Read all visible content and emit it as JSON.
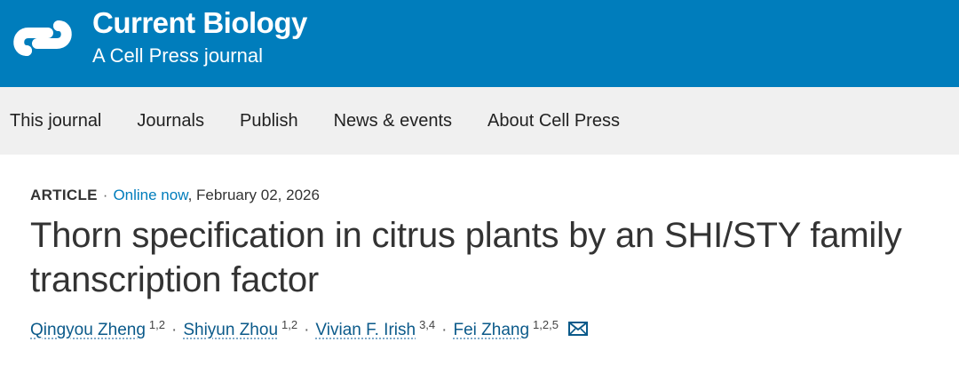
{
  "header": {
    "brand_title": "Current Biology",
    "brand_subtitle": "A Cell Press journal",
    "logo_icon": "cell-press-logo-icon"
  },
  "nav": {
    "items": [
      "This journal",
      "Journals",
      "Publish",
      "News & events",
      "About Cell Press"
    ]
  },
  "article": {
    "type": "ARTICLE",
    "separator": "·",
    "status": "Online now",
    "date": ", February 02, 2026",
    "title_line1": "Thorn specification in citrus plants by an SHI/STY family",
    "title_line2": "transcription factor",
    "authors": [
      {
        "name": "Qingyou Zheng",
        "aff": "1,2"
      },
      {
        "name": "Shiyun Zhou",
        "aff": "1,2"
      },
      {
        "name": "Vivian F. Irish",
        "aff": "3,4"
      },
      {
        "name": "Fei Zhang",
        "aff": "1,2,5"
      }
    ],
    "contact_icon": "envelope-icon"
  },
  "colors": {
    "header_bg": "#007dbc",
    "nav_bg": "#f0f0f0",
    "link": "#0b5a8a",
    "accent": "#007dbc"
  }
}
